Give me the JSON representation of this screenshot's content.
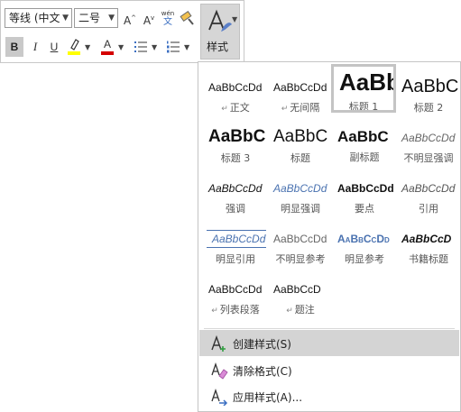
{
  "toolbar": {
    "font_name": "等线 (中文",
    "font_size": "二号",
    "grow_font": "A",
    "shrink_font": "A",
    "phonetic_top": "wén",
    "phonetic_bottom": "文",
    "bold": "B",
    "italic": "I",
    "underline": "U",
    "font_color_letter": "A",
    "styles_label": "样式",
    "highlight_color": "#ffff00",
    "font_color": "#d40000"
  },
  "gallery": {
    "styles": [
      {
        "sample": "AaBbCcDd",
        "name": "正文",
        "mark": "↵"
      },
      {
        "sample": "AaBbCcDd",
        "name": "无间隔",
        "mark": "↵"
      },
      {
        "sample": "AaBb",
        "name": "标题 1",
        "selected": true
      },
      {
        "sample": "AaBbC",
        "name": "标题 2"
      },
      {
        "sample": "AaBbC",
        "name": "标题 3"
      },
      {
        "sample": "AaBbC",
        "name": "标题"
      },
      {
        "sample": "AaBbC",
        "name": "副标题"
      },
      {
        "sample": "AaBbCcDd",
        "name": "不明显强调"
      },
      {
        "sample": "AaBbCcDd",
        "name": "强调"
      },
      {
        "sample": "AaBbCcDd",
        "name": "明显强调"
      },
      {
        "sample": "AaBbCcDd",
        "name": "要点"
      },
      {
        "sample": "AaBbCcDd",
        "name": "引用"
      },
      {
        "sample": "AaBbCcDd",
        "name": "明显引用"
      },
      {
        "sample": "AaBbCcDd",
        "name": "不明显参考"
      },
      {
        "sample": "AaBbCcDd",
        "name": "明显参考"
      },
      {
        "sample": "AaBbCcD",
        "name": "书籍标题"
      },
      {
        "sample": "AaBbCcDd",
        "name": "列表段落",
        "mark": "↵"
      },
      {
        "sample": "AaBbCcD",
        "name": "题注",
        "mark": "↵"
      }
    ]
  },
  "menu": {
    "create_style": "创建样式(S)",
    "clear_format": "清除格式(C)",
    "apply_style": "应用样式(A)..."
  },
  "colors": {
    "accent_blue": "#4a72b0",
    "hover_gray": "#d4d4d4"
  }
}
